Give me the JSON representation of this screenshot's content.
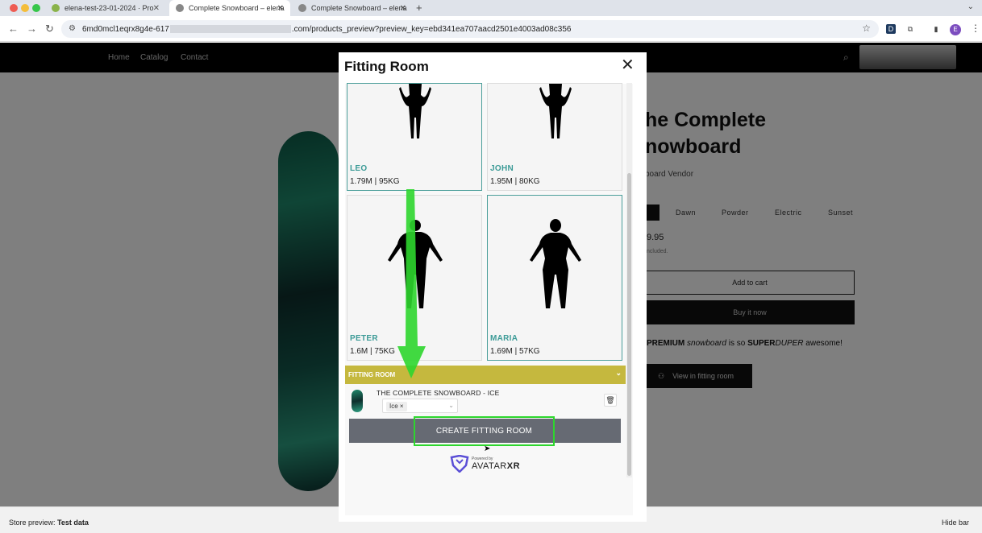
{
  "browser": {
    "tabs": [
      {
        "label": "elena-test-23-01-2024 · Pro"
      },
      {
        "label": "Complete Snowboard – elena"
      },
      {
        "label": "Complete Snowboard – elena"
      }
    ],
    "new_tab": "+",
    "url_prefix": "6md0mcl1eqrx8g4e-617",
    "url_suffix": ".com/products_preview?preview_key=ebd341ea707aacd2501e4003ad08c356",
    "profile_initial": "E"
  },
  "store": {
    "nav": [
      "Home",
      "Catalog",
      "Contact"
    ],
    "product_title_line1": "he Complete",
    "product_title_line2": "nowboard",
    "vendor": "board Vendor",
    "variants": [
      "Dawn",
      "Powder",
      "Electric",
      "Sunset"
    ],
    "price": "9.95",
    "tax_note": "ncluded.",
    "add_to_cart": "Add to cart",
    "buy_now": "Buy it now",
    "description_parts": [
      "PREMIUM",
      " ",
      "snowboard",
      " is so ",
      "SUPER",
      "DUPER",
      " awesome!"
    ],
    "view_fitting_room": "View in fitting room"
  },
  "modal": {
    "title": "Fitting Room",
    "close": "✕",
    "avatars": [
      {
        "name": "LEO",
        "stats": "1.79M | 95KG"
      },
      {
        "name": "JOHN",
        "stats": "1.95M | 80KG"
      },
      {
        "name": "PETER",
        "stats": "1.6M | 75KG"
      },
      {
        "name": "MARIA",
        "stats": "1.69M | 57KG"
      }
    ],
    "fitting_section": "FITTING ROOM",
    "item_title": "THE COMPLETE SNOWBOARD - ICE",
    "item_tag": "Ice ×",
    "create_button": "CREATE FITTING ROOM",
    "powered_by": "Powered by",
    "brand_name": "AVATAR",
    "brand_suffix": "XR"
  },
  "bottom_bar": {
    "left_label": "Store preview:",
    "left_value": "Test data",
    "right_label": "Hide bar"
  },
  "colors": {
    "accent_teal": "#3c9b97",
    "fitting_header": "#c5b83e",
    "highlight_green": "#2dd62d"
  }
}
